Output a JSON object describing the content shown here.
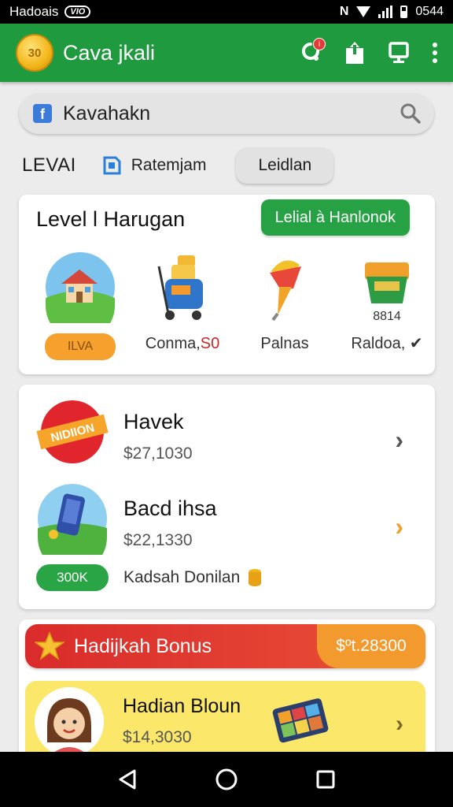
{
  "status_bar": {
    "carrier": "Hadoais",
    "pill": "VIO",
    "time": "0544"
  },
  "app_bar": {
    "logo_text": "30",
    "title": "Cava jkali",
    "notification_badge": "i"
  },
  "search": {
    "query": "Kavahakn"
  },
  "tabs": {
    "level": "LEVAI",
    "rank": "Ratemjam",
    "chip": "Leidlan"
  },
  "level_card": {
    "title": "Level l Harugan",
    "action_label": "Lelial à Hanlonok",
    "items": [
      {
        "chip": "ILVA"
      },
      {
        "label": "Conma,",
        "value": "S0"
      },
      {
        "label": "Palnas"
      },
      {
        "number": "8814",
        "label": "Raldoa,"
      }
    ]
  },
  "offers_card": {
    "items": [
      {
        "badge_text": "NIDIION",
        "name": "Havek",
        "price": "$27,1030"
      },
      {
        "name": "Bacd ihsa",
        "price": "$22,1330"
      }
    ],
    "footer_chip": "300K",
    "footer_text": "Kadsah Donilan"
  },
  "bonus_card": {
    "title": "Hadijkah Bonus",
    "amount": "$ºt.28300",
    "promo_name": "Hadian Bloun",
    "promo_price": "$14,3030"
  },
  "colors": {
    "primary_green": "#1f9a3e",
    "accent_orange": "#f6a02d",
    "bonus_red": "#d92b2b",
    "promo_yellow": "#fbe76a"
  }
}
